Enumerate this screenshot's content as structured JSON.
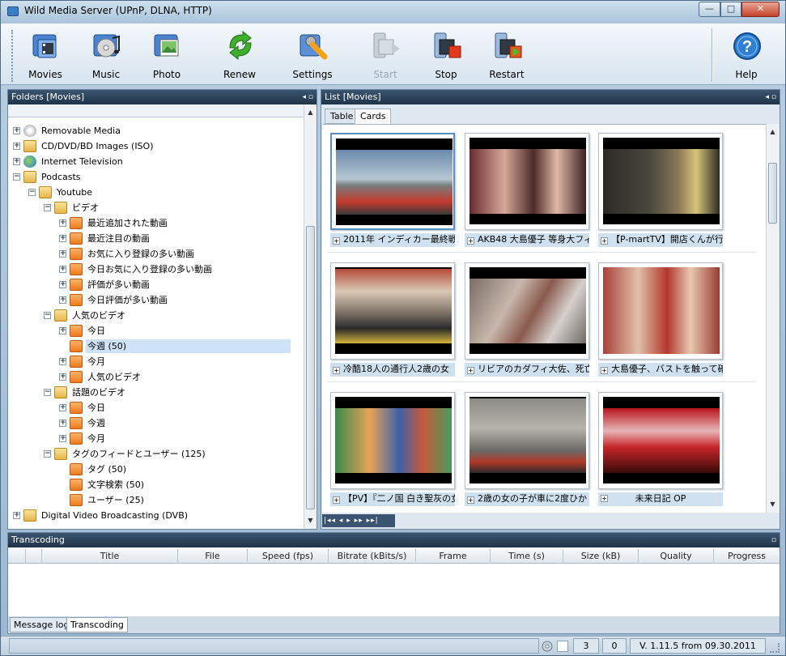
{
  "window": {
    "title": "Wild Media Server (UPnP, DLNA, HTTP)",
    "min": "—",
    "max": "□",
    "close": "✕"
  },
  "toolbar": {
    "movies": "Movies",
    "music": "Music",
    "photo": "Photo",
    "renew": "Renew",
    "settings": "Settings",
    "start": "Start",
    "stop": "Stop",
    "restart": "Restart",
    "help": "Help"
  },
  "folders": {
    "header": "Folders [Movies]",
    "pin": "◂ ▫",
    "tree": [
      {
        "label": "Removable Media"
      },
      {
        "label": "CD/DVD/BD Images (ISO)"
      },
      {
        "label": "Internet Television"
      },
      {
        "label": "Podcasts"
      },
      {
        "label": "Youtube"
      },
      {
        "label": "ビデオ"
      },
      {
        "label": "最近追加された動画"
      },
      {
        "label": "最近注目の動画"
      },
      {
        "label": "お気に入り登録の多い動画"
      },
      {
        "label": "今日お気に入り登録の多い動画"
      },
      {
        "label": "評価が多い動画"
      },
      {
        "label": "今日評価が多い動画"
      },
      {
        "label": "人気のビデオ"
      },
      {
        "label": "今日"
      },
      {
        "label": "今週 (50)"
      },
      {
        "label": "今月"
      },
      {
        "label": "人気のビデオ"
      },
      {
        "label": "話題のビデオ"
      },
      {
        "label": "今日"
      },
      {
        "label": "今週"
      },
      {
        "label": "今月"
      },
      {
        "label": "タグのフィードとユーザー (125)"
      },
      {
        "label": "タグ (50)"
      },
      {
        "label": "文字検索 (50)"
      },
      {
        "label": "ユーザー (25)"
      },
      {
        "label": "Digital Video Broadcasting (DVB)"
      }
    ]
  },
  "list": {
    "header": "List [Movies]",
    "pin": "◂ ▫",
    "tabs": [
      "Table",
      "Cards"
    ],
    "cards": [
      {
        "caption": "2011年 インディカー最終戦",
        "color": "#6d8aa6"
      },
      {
        "caption": "AKB48 大島優子 等身大フィ",
        "color": "#b4707a"
      },
      {
        "caption": "【P-martTV】開店くんが行く！",
        "color": "#3b3a33"
      },
      {
        "caption": "冷酷18人の通行人2歳の女",
        "color": "#8b7c6c"
      },
      {
        "caption": "リビアのカダフィ大佐、死亡",
        "color": "#9a8c83"
      },
      {
        "caption": "大島優子、バストを触って確",
        "color": "#c9a58c"
      },
      {
        "caption": "【PV】『二ノ国 白き聖灰の女",
        "color": "#4f8a63"
      },
      {
        "caption": "2歳の女の子が車に2度ひか",
        "color": "#8a8a84"
      },
      {
        "caption": "未来日記 OP",
        "color": "#c7262a"
      }
    ],
    "pager": "|◂◂ ◂ ▸ ▸▸ ▸▸|"
  },
  "transcoding": {
    "header": "Transcoding",
    "pin": "▫",
    "columns": [
      "Title",
      "File",
      "Speed (fps)",
      "Bitrate (kBits/s)",
      "Frame",
      "Time (s)",
      "Size (kB)",
      "Quality",
      "Progress"
    ],
    "tabs": [
      "Message log",
      "Transcoding"
    ]
  },
  "status": {
    "count1": "3",
    "count2": "0",
    "version": "V. 1.11.5 from 09.30.2011"
  }
}
